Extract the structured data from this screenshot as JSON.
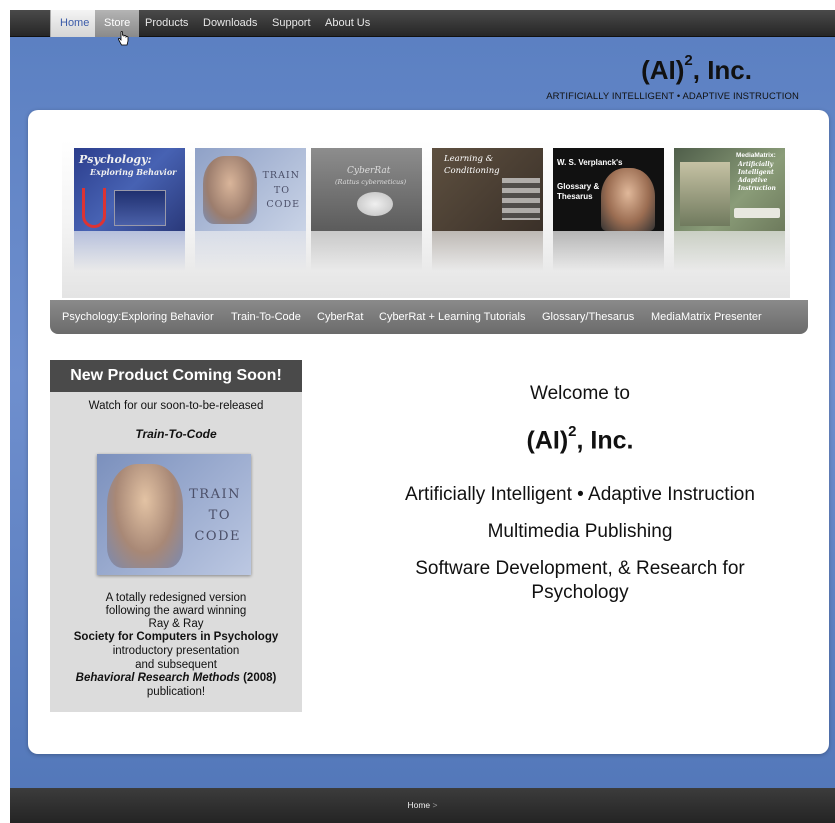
{
  "topnav": {
    "tabs": [
      {
        "label": "Home",
        "state": "active"
      },
      {
        "label": "Store",
        "state": "hover"
      },
      {
        "label": "Products",
        "state": "normal"
      },
      {
        "label": "Downloads",
        "state": "normal"
      },
      {
        "label": "Support",
        "state": "normal"
      },
      {
        "label": "About Us",
        "state": "normal"
      }
    ]
  },
  "brand": {
    "name": "(AI)",
    "superscript": "2",
    "suffix": ", Inc.",
    "tagline": "ARTIFICIALLY INTELLIGENT • ADAPTIVE INSTRUCTION"
  },
  "covers": {
    "psych": {
      "line1": "Psychology:",
      "line2": "Exploring Behavior"
    },
    "train": {
      "w1": "TRAIN",
      "w2": "TO",
      "w3": "CODE"
    },
    "cyber": {
      "line1": "CyberRat",
      "line2": "(Rattus cyberneticus)"
    },
    "learn": {
      "line1": "Learning &",
      "line2": "Conditioning"
    },
    "gloss": {
      "line1": "W. S. Verplanck's",
      "line2": "Glossary &",
      "line3": "Thesarus"
    },
    "media": {
      "line1": "MediaMatrix:",
      "line2": "Artificially",
      "line3": "Intelligent",
      "line4": "Adaptive",
      "line5": "Instruction"
    }
  },
  "product_nav": {
    "items": [
      "Psychology:Exploring Behavior",
      "Train-To-Code",
      "CyberRat",
      "CyberRat + Learning Tutorials",
      "Glossary/Thesarus",
      "MediaMatrix Presenter"
    ]
  },
  "sidebar": {
    "heading": "New Product Coming Soon!",
    "intro": "Watch for our soon-to-be-released",
    "product": "Train-To-Code",
    "image_words": {
      "w1": "TRAIN",
      "w2": "TO",
      "w3": "CODE"
    },
    "lines": [
      "A totally redesigned version",
      "following the award winning",
      "Ray & Ray",
      "Society for Computers in Psychology",
      "introductory presentation",
      "and subsequent",
      "Behavioral Research Methods",
      " (2008)",
      "publication!"
    ]
  },
  "welcome": {
    "line1": "Welcome to",
    "company": "(AI)",
    "company_sup": "2",
    "company_suffix": ", Inc.",
    "line3": "Artificially Intelligent • Adaptive Instruction",
    "line4": "Multimedia Publishing",
    "line5": "Software Development, & Research for",
    "line6": "Psychology"
  },
  "footer": {
    "breadcrumb": "Home",
    "breadcrumb_sep": " >"
  }
}
